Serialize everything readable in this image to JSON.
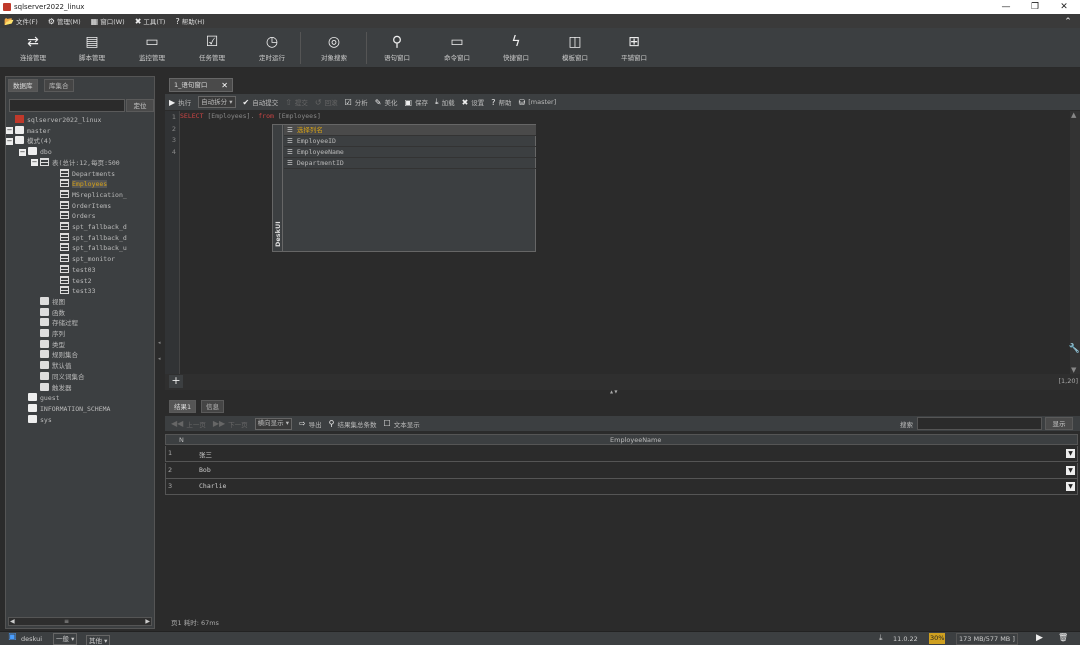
{
  "window": {
    "title": "sqlserver2022_linux",
    "minimize": "—",
    "restore": "❐",
    "close": "✕"
  },
  "menu": [
    {
      "icon": "folder-icon",
      "glyph": "📂",
      "label": "文件(F)"
    },
    {
      "icon": "gear-icon",
      "glyph": "⚙",
      "label": "管理(M)"
    },
    {
      "icon": "window-icon",
      "glyph": "▦",
      "label": "窗口(W)"
    },
    {
      "icon": "tools-icon",
      "glyph": "✖",
      "label": "工具(T)"
    },
    {
      "icon": "help-icon",
      "glyph": "?",
      "label": "帮助(H)"
    }
  ],
  "collapse_glyph": "⌃",
  "toolbar": [
    {
      "icon": "connection-icon",
      "glyph": "⇄",
      "label": "连接管理"
    },
    {
      "icon": "script-icon",
      "glyph": "▤",
      "label": "脚本管理"
    },
    {
      "icon": "monitor-icon",
      "glyph": "▭",
      "label": "监控管理"
    },
    {
      "icon": "task-icon",
      "glyph": "☑",
      "label": "任务管理"
    },
    {
      "icon": "clock-icon",
      "glyph": "◷",
      "label": "定时运行"
    },
    {
      "icon": "object-search-icon",
      "glyph": "◎",
      "label": "对象搜索"
    },
    {
      "icon": "search-icon",
      "glyph": "⚲",
      "label": "语句窗口"
    },
    {
      "icon": "command-icon",
      "glyph": "▭",
      "label": "命令窗口"
    },
    {
      "icon": "lightning-icon",
      "glyph": "ϟ",
      "label": "快捷窗口"
    },
    {
      "icon": "template-icon",
      "glyph": "◫",
      "label": "模板窗口"
    },
    {
      "icon": "tile-icon",
      "glyph": "⊞",
      "label": "平铺窗口"
    }
  ],
  "left": {
    "tabs": [
      "数据库",
      "库集合"
    ],
    "locate": "定位",
    "scroll_mid": "≡",
    "tree": [
      {
        "label": "sqlserver2022_linux",
        "depth": 0,
        "icon": "server-icon",
        "exp": ""
      },
      {
        "label": "master",
        "depth": 0,
        "icon": "database-icon",
        "exp": "−"
      },
      {
        "label": "模式(4)",
        "depth": 1,
        "icon": "folder-icon",
        "exp": "−"
      },
      {
        "label": "dbo",
        "depth": 2,
        "icon": "folder-icon",
        "exp": "−"
      },
      {
        "label": "表(总计:12,每页:500",
        "depth": 3,
        "icon": "table-icon",
        "exp": "−"
      },
      {
        "label": "Departments",
        "depth": 4,
        "icon": "table-icon",
        "exp": ""
      },
      {
        "label": "Employees",
        "depth": 4,
        "icon": "table-icon",
        "exp": "",
        "hl": true
      },
      {
        "label": "MSreplication_",
        "depth": 4,
        "icon": "table-icon",
        "exp": ""
      },
      {
        "label": "OrderItems",
        "depth": 4,
        "icon": "table-icon",
        "exp": ""
      },
      {
        "label": "Orders",
        "depth": 4,
        "icon": "table-icon",
        "exp": ""
      },
      {
        "label": "spt_fallback_d",
        "depth": 4,
        "icon": "table-icon",
        "exp": ""
      },
      {
        "label": "spt_fallback_d",
        "depth": 4,
        "icon": "table-icon",
        "exp": ""
      },
      {
        "label": "spt_fallback_u",
        "depth": 4,
        "icon": "table-icon",
        "exp": ""
      },
      {
        "label": "spt_monitor",
        "depth": 4,
        "icon": "table-icon",
        "exp": ""
      },
      {
        "label": "test03",
        "depth": 4,
        "icon": "table-icon",
        "exp": ""
      },
      {
        "label": "test2",
        "depth": 4,
        "icon": "table-icon",
        "exp": ""
      },
      {
        "label": "test33",
        "depth": 4,
        "icon": "table-icon",
        "exp": ""
      },
      {
        "label": "视图",
        "depth": 3,
        "icon": "view-icon",
        "exp": ""
      },
      {
        "label": "函数",
        "depth": 3,
        "icon": "function-icon",
        "exp": ""
      },
      {
        "label": "存储过程",
        "depth": 3,
        "icon": "procedure-icon",
        "exp": ""
      },
      {
        "label": "序列",
        "depth": 3,
        "icon": "sequence-icon",
        "exp": ""
      },
      {
        "label": "类型",
        "depth": 3,
        "icon": "type-icon",
        "exp": ""
      },
      {
        "label": "规则集合",
        "depth": 3,
        "icon": "rule-icon",
        "exp": ""
      },
      {
        "label": "默认值",
        "depth": 3,
        "icon": "default-icon",
        "exp": ""
      },
      {
        "label": "同义词集合",
        "depth": 3,
        "icon": "synonym-icon",
        "exp": ""
      },
      {
        "label": "触发器",
        "depth": 3,
        "icon": "trigger-icon",
        "exp": ""
      },
      {
        "label": "guest",
        "depth": 2,
        "icon": "folder-icon",
        "exp": ""
      },
      {
        "label": "INFORMATION_SCHEMA",
        "depth": 2,
        "icon": "folder-icon",
        "exp": ""
      },
      {
        "label": "sys",
        "depth": 2,
        "icon": "folder-icon",
        "exp": ""
      }
    ]
  },
  "editor": {
    "tab": "1_语句窗口",
    "tools": [
      {
        "icon": "run-icon",
        "glyph": "▶",
        "label": "执行"
      },
      {
        "icon": "",
        "glyph": "",
        "label": "自动拆分 ▾",
        "select": true
      },
      {
        "icon": "check-icon",
        "glyph": "✔",
        "label": "自动提交"
      },
      {
        "icon": "commit-icon",
        "glyph": "⇧",
        "label": "提交",
        "dis": true
      },
      {
        "icon": "rollback-icon",
        "glyph": "↺",
        "label": "回滚",
        "dis": true
      },
      {
        "icon": "analyze-icon",
        "glyph": "☑",
        "label": "分析"
      },
      {
        "icon": "beautify-icon",
        "glyph": "✎",
        "label": "美化"
      },
      {
        "icon": "save-icon",
        "glyph": "▣",
        "label": "保存"
      },
      {
        "icon": "load-icon",
        "glyph": "⤓",
        "label": "加载"
      },
      {
        "icon": "settings-icon",
        "glyph": "✖",
        "label": "设置"
      },
      {
        "icon": "help-icon",
        "glyph": "?",
        "label": "帮助"
      },
      {
        "icon": "database-icon",
        "glyph": "⛁",
        "label": "[master]"
      }
    ],
    "lines": [
      "1",
      "2",
      "3",
      "4"
    ],
    "sql": {
      "kw1": "SELECT",
      "p1": " [Employees].",
      "kw2": " from",
      "p2": " [Employees]"
    },
    "popup_side": "DeskUI",
    "popup": [
      {
        "label": "选择列名",
        "hl": true
      },
      {
        "label": "EmployeeID"
      },
      {
        "label": "EmployeeName"
      },
      {
        "label": "DepartmentID"
      }
    ],
    "add": "+",
    "wrench": "🔧",
    "caret_up": "▲",
    "caret_down": "▼",
    "collapse_arrow": "◂",
    "dots": "▲ ▼",
    "cursor": "[1,20]"
  },
  "result": {
    "tabs": [
      "结果1",
      "信息"
    ],
    "tools": [
      {
        "icon": "first-page-icon",
        "glyph": "◀◀",
        "label": "上一页",
        "dis": true
      },
      {
        "icon": "next-page-icon",
        "glyph": "▶▶",
        "label": "下一页",
        "dis": true
      },
      {
        "icon": "",
        "glyph": "",
        "label": "横向显示 ▾",
        "select": true
      },
      {
        "icon": "export-icon",
        "glyph": "⇨",
        "label": "导出"
      },
      {
        "icon": "search-icon",
        "glyph": "⚲",
        "label": "结果集总条数"
      },
      {
        "icon": "checkbox-icon",
        "glyph": "☐",
        "label": "文本显示"
      }
    ],
    "search_label": "搜索",
    "show_btn": "显示",
    "col_num": "N",
    "col_name": "EmployeeName",
    "rows": [
      {
        "n": "1",
        "v": "张三"
      },
      {
        "n": "2",
        "v": "Bob"
      },
      {
        "n": "3",
        "v": "Charlie"
      }
    ],
    "dd": "▼",
    "footer": "页1   耗时: 67ms"
  },
  "status": {
    "user": "deskui",
    "level": "一般 ▾",
    "other": "其他 ▾",
    "version": "11.0.22",
    "mem_pct": "30%",
    "mem": "173 MB/577 MB ]",
    "run": "▶",
    "trash": "🗑"
  }
}
